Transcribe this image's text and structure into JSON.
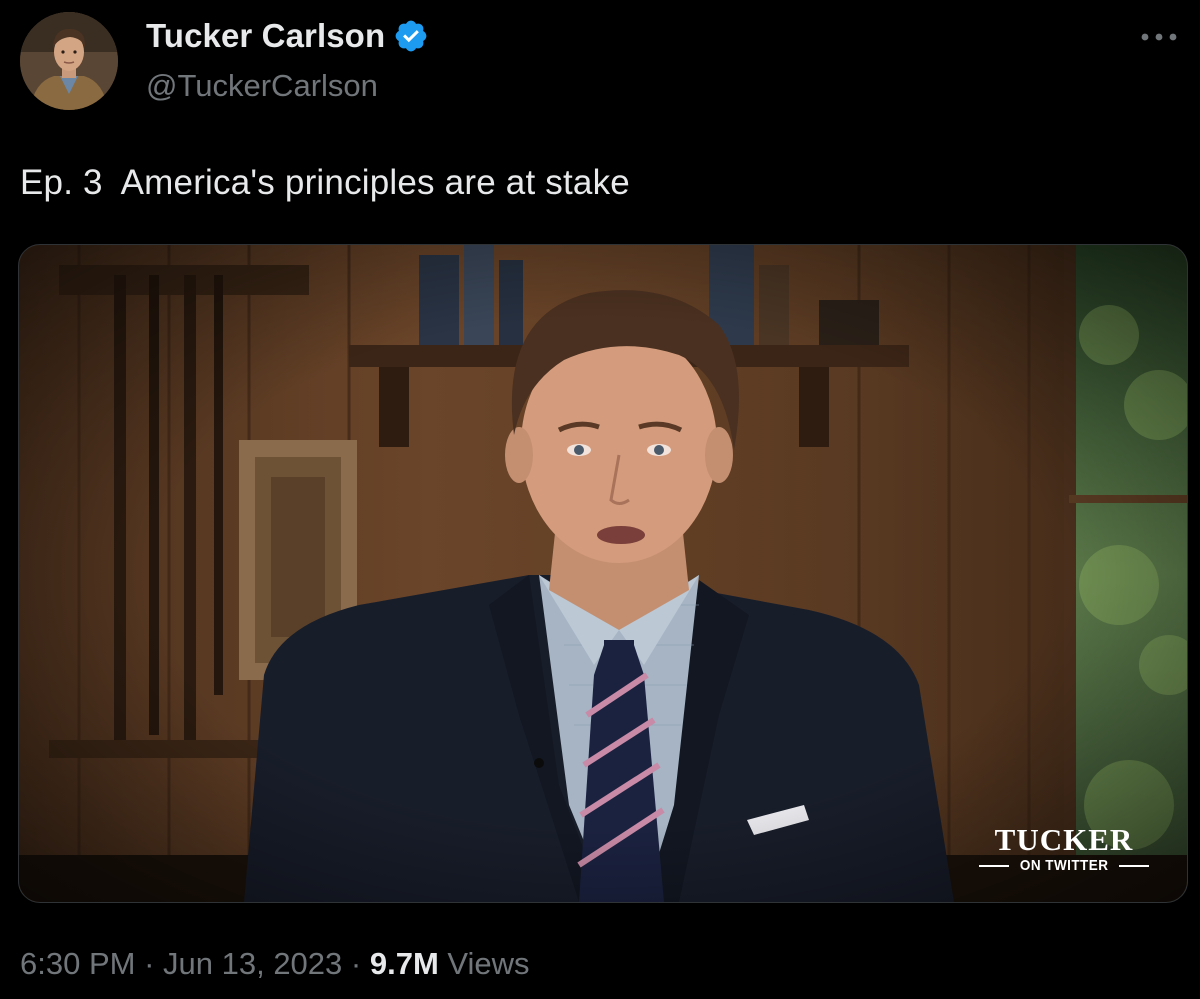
{
  "author": {
    "display_name": "Tucker Carlson",
    "handle": "@TuckerCarlson",
    "verified_badge_color": "#1d9bf0",
    "avatar_icon": "profile-photo"
  },
  "more_icon": "more-horizontal-icon",
  "tweet": {
    "text": "Ep. 3  America's principles are at stake"
  },
  "media": {
    "type": "video-still",
    "watermark_main": "TUCKER",
    "watermark_sub": "ON TWITTER"
  },
  "meta": {
    "time": "6:30 PM",
    "separator1": " · ",
    "date": "Jun 13, 2023",
    "separator2": " · ",
    "views_count": "9.7M",
    "views_label": " Views"
  },
  "colors": {
    "background": "#000000",
    "primary_text": "#e7e9ea",
    "secondary_text": "#71767b",
    "border": "#2f3336"
  }
}
